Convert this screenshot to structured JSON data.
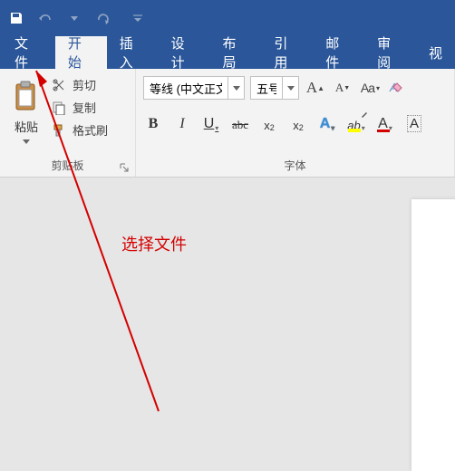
{
  "qat": {
    "save": "save",
    "undo": "undo",
    "redo": "redo",
    "customize": "customize"
  },
  "tabs": {
    "file": "文件",
    "home": "开始",
    "insert": "插入",
    "design": "设计",
    "layout": "布局",
    "references": "引用",
    "mailings": "邮件",
    "review": "审阅",
    "view": "视"
  },
  "clipboard": {
    "paste": "粘贴",
    "cut": "剪切",
    "copy": "复制",
    "format_painter": "格式刷",
    "group_label": "剪贴板"
  },
  "font": {
    "font_name": "等线 (中文正文",
    "font_size": "五号",
    "grow": "A",
    "shrink": "A",
    "change_case": "Aa",
    "bold": "B",
    "italic": "I",
    "underline": "U",
    "strike": "abc",
    "subscript_base": "x",
    "superscript_base": "x",
    "text_effects": "A",
    "highlight": "ab",
    "font_color": "A",
    "char_shading": "A",
    "group_label": "字体"
  },
  "annotation": {
    "text": "选择文件"
  }
}
